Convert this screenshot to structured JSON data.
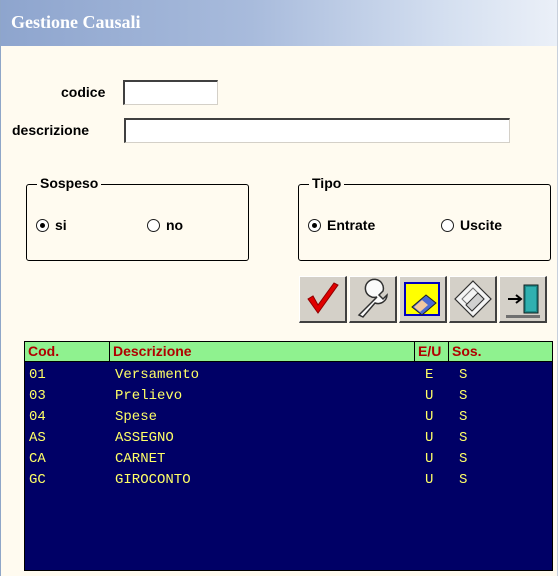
{
  "window": {
    "title": "Gestione Causali"
  },
  "form": {
    "codice_label": "codice",
    "codice_value": "",
    "descrizione_label": "descrizione",
    "descrizione_value": ""
  },
  "sospeso": {
    "legend": "Sospeso",
    "options": [
      {
        "label": "si",
        "selected": true
      },
      {
        "label": "no",
        "selected": false
      }
    ]
  },
  "tipo": {
    "legend": "Tipo",
    "options": [
      {
        "label": "Entrate",
        "selected": true
      },
      {
        "label": "Uscite",
        "selected": false
      }
    ]
  },
  "toolbar": {
    "buttons": [
      {
        "name": "confirm",
        "icon": "checkmark-icon"
      },
      {
        "name": "tools",
        "icon": "wrench-icon"
      },
      {
        "name": "erase",
        "icon": "eraser-icon"
      },
      {
        "name": "clear",
        "icon": "eraser-diamond-icon"
      },
      {
        "name": "exit",
        "icon": "exit-door-icon"
      }
    ]
  },
  "table": {
    "columns": [
      "Cod.",
      "Descrizione",
      "E/U",
      "Sos."
    ],
    "rows": [
      {
        "cod": "01",
        "descrizione": "Versamento",
        "eu": "E",
        "sos": "S"
      },
      {
        "cod": "03",
        "descrizione": "Prelievo",
        "eu": "U",
        "sos": "S"
      },
      {
        "cod": "04",
        "descrizione": "Spese",
        "eu": "U",
        "sos": "S"
      },
      {
        "cod": "AS",
        "descrizione": "ASSEGNO",
        "eu": "U",
        "sos": "S"
      },
      {
        "cod": "CA",
        "descrizione": "CARNET",
        "eu": "U",
        "sos": "S"
      },
      {
        "cod": "GC",
        "descrizione": "GIROCONTO",
        "eu": "U",
        "sos": "S"
      }
    ]
  },
  "colors": {
    "window_bg": "#fffbf0",
    "grid_bg": "#000066",
    "grid_text": "#ffff66",
    "header_bg": "#8ff28f",
    "header_text": "#b00000",
    "check_red": "#e00000"
  }
}
